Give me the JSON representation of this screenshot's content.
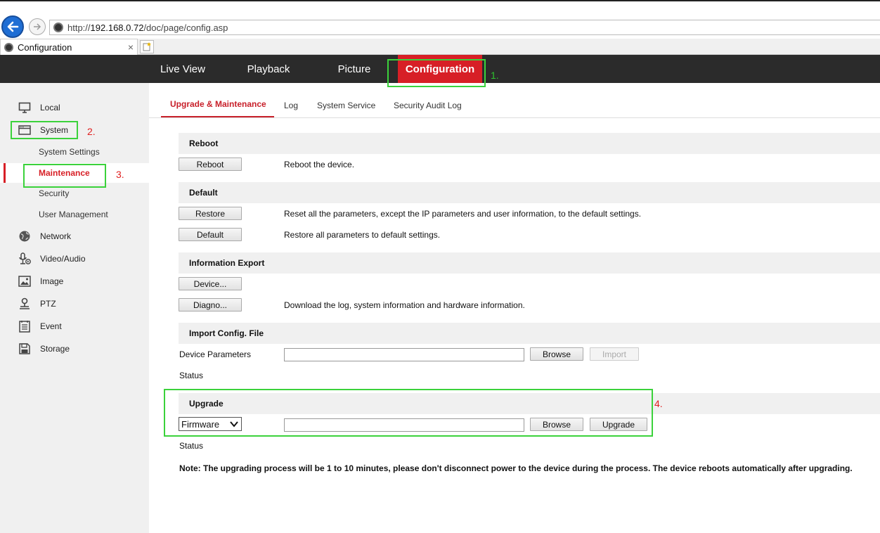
{
  "browser": {
    "url_prefix": "http://",
    "url_host": "192.168.0.72",
    "url_path": "/doc/page/config.asp",
    "tab_title": "Configuration",
    "tab_close": "×"
  },
  "topnav": {
    "items": [
      {
        "label": "Live View"
      },
      {
        "label": "Playback"
      },
      {
        "label": "Picture"
      },
      {
        "label": "Configuration"
      }
    ],
    "active": "Configuration"
  },
  "sidebar": {
    "items": [
      {
        "label": "Local",
        "icon": "monitor-icon"
      },
      {
        "label": "System",
        "icon": "window-icon"
      },
      {
        "label": "Network",
        "icon": "globe-icon"
      },
      {
        "label": "Video/Audio",
        "icon": "microphone-icon"
      },
      {
        "label": "Image",
        "icon": "picture-icon"
      },
      {
        "label": "PTZ",
        "icon": "ptz-icon"
      },
      {
        "label": "Event",
        "icon": "list-icon"
      },
      {
        "label": "Storage",
        "icon": "disk-icon"
      }
    ],
    "system_sub": [
      {
        "label": "System Settings"
      },
      {
        "label": "Maintenance"
      },
      {
        "label": "Security"
      },
      {
        "label": "User Management"
      }
    ],
    "active_sub": "Maintenance"
  },
  "content_tabs": {
    "items": [
      {
        "label": "Upgrade & Maintenance"
      },
      {
        "label": "Log"
      },
      {
        "label": "System Service"
      },
      {
        "label": "Security Audit Log"
      }
    ],
    "active": "Upgrade & Maintenance"
  },
  "reboot": {
    "heading": "Reboot",
    "button": "Reboot",
    "desc": "Reboot the device."
  },
  "default": {
    "heading": "Default",
    "restore_button": "Restore",
    "restore_desc": "Reset all the parameters, except the IP parameters and user information, to the default settings.",
    "default_button": "Default",
    "default_desc": "Restore all parameters to default settings."
  },
  "export": {
    "heading": "Information Export",
    "device_button": "Device...",
    "diagno_button": "Diagno...",
    "diagno_desc": "Download the log, system information and hardware information."
  },
  "import": {
    "heading": "Import Config. File",
    "label": "Device Parameters",
    "path_value": "",
    "browse_button": "Browse",
    "import_button": "Import",
    "status_label": "Status"
  },
  "upgrade": {
    "heading": "Upgrade",
    "select_value": "Firmware",
    "path_value": "",
    "browse_button": "Browse",
    "upgrade_button": "Upgrade",
    "status_label": "Status",
    "note": "Note: The upgrading process will be 1 to 10 minutes, please don't disconnect power to the device during the process. The device reboots automatically after upgrading."
  },
  "annotations": {
    "n1": "1.",
    "n2": "2.",
    "n3": "3.",
    "n4": "4.",
    "box_color": "#3bd23b",
    "label_color_1": "#2fc22f",
    "label_color_other": "#e02020"
  },
  "colors": {
    "accent": "#d71f26",
    "nav_bg": "#2b2b2b",
    "sidebar_bg": "#f0f0f0"
  }
}
